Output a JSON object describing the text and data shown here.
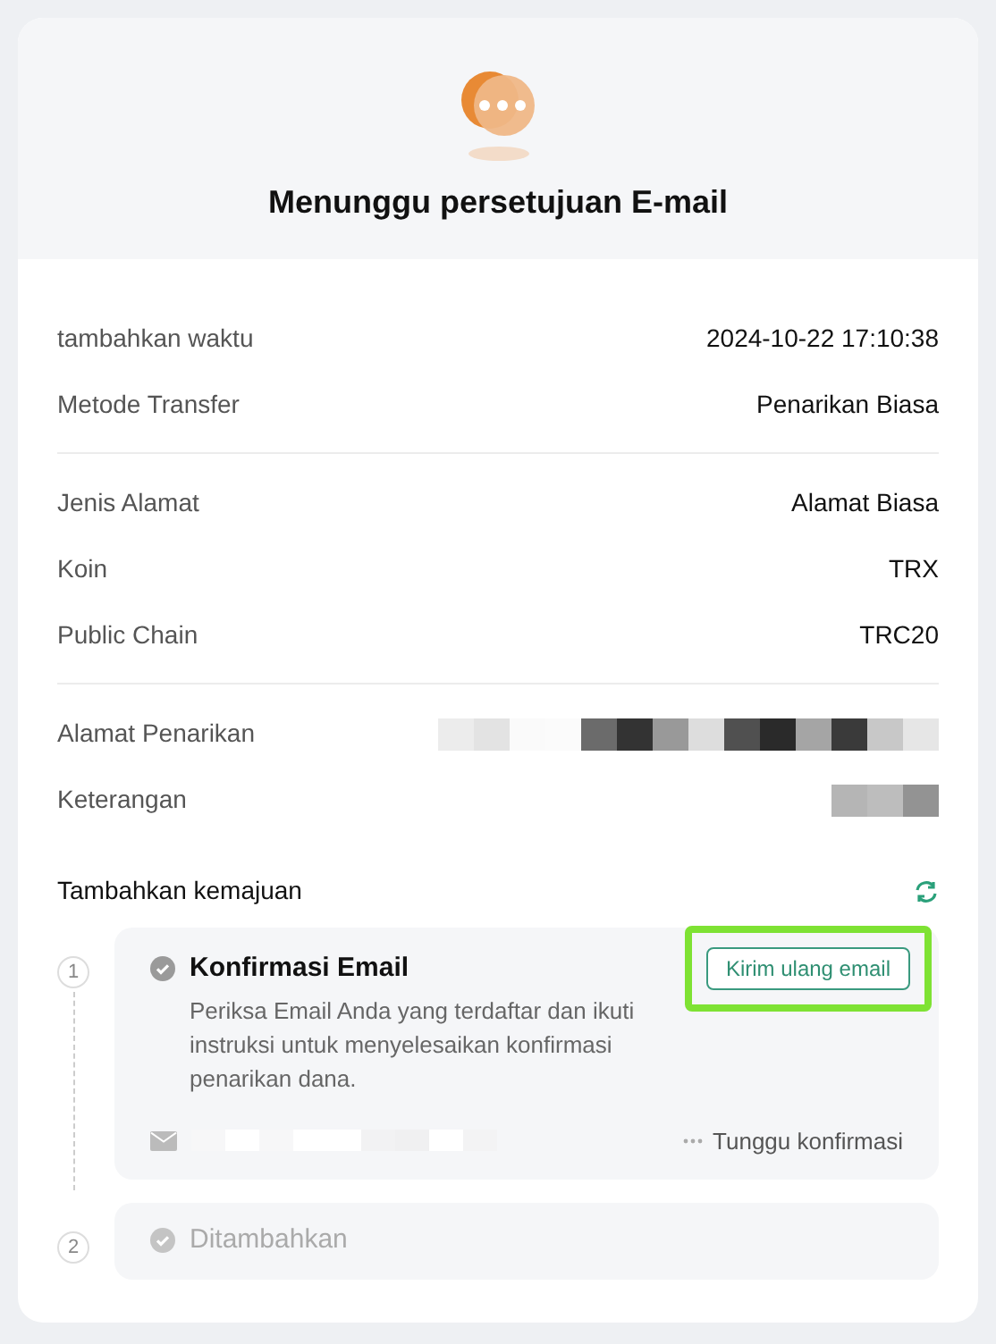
{
  "title": "Menunggu persetujuan E-mail",
  "groups": [
    [
      {
        "label": "tambahkan waktu",
        "value": "2024-10-22 17:10:38"
      },
      {
        "label": "Metode Transfer",
        "value": "Penarikan Biasa"
      }
    ],
    [
      {
        "label": "Jenis Alamat",
        "value": "Alamat Biasa"
      },
      {
        "label": "Koin",
        "value": "TRX"
      },
      {
        "label": "Public Chain",
        "value": "TRC20"
      }
    ],
    [
      {
        "label": "Alamat Penarikan",
        "kind": "redacted"
      },
      {
        "label": "Keterangan",
        "kind": "redacted"
      }
    ]
  ],
  "progress": {
    "title": "Tambahkan kemajuan",
    "steps": [
      {
        "number": "1",
        "title": "Konfirmasi Email",
        "active": true,
        "description": "Periksa Email Anda yang terdaftar dan ikuti instruksi untuk menyelesaikan konfirmasi penarikan dana.",
        "button": {
          "label": "Kirim ulang email",
          "highlighted": true
        },
        "status": "Tunggu konfirmasi"
      },
      {
        "number": "2",
        "title": "Ditambahkan",
        "active": false
      }
    ]
  }
}
